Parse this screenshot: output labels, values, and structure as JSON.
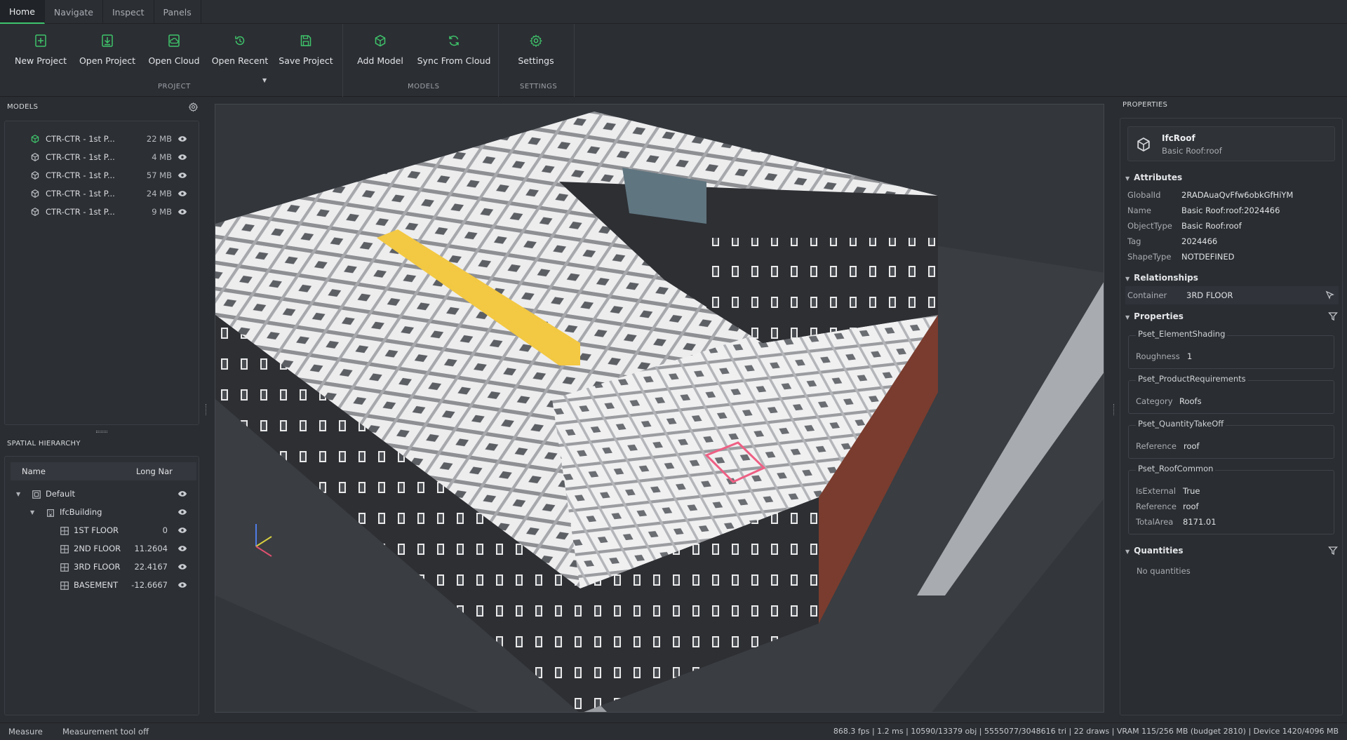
{
  "tabs": [
    {
      "label": "Home",
      "active": true
    },
    {
      "label": "Navigate",
      "active": false
    },
    {
      "label": "Inspect",
      "active": false
    },
    {
      "label": "Panels",
      "active": false
    }
  ],
  "ribbon": {
    "buttons": {
      "new_project": "New Project",
      "open_project": "Open Project",
      "open_cloud": "Open Cloud",
      "open_recent": "Open Recent",
      "save_project": "Save Project",
      "add_model": "Add Model",
      "sync_from_cloud": "Sync From Cloud",
      "settings": "Settings"
    },
    "groups": {
      "project": "PROJECT",
      "models": "MODELS",
      "settings": "SETTINGS"
    },
    "accent": "#3fc46b"
  },
  "models_panel": {
    "title": "MODELS",
    "items": [
      {
        "name": "CTR-CTR - 1st P...",
        "size": "22 MB",
        "active": true
      },
      {
        "name": "CTR-CTR - 1st P...",
        "size": "4 MB",
        "active": false
      },
      {
        "name": "CTR-CTR - 1st P...",
        "size": "57 MB",
        "active": false
      },
      {
        "name": "CTR-CTR - 1st P...",
        "size": "24 MB",
        "active": false
      },
      {
        "name": "CTR-CTR - 1st P...",
        "size": "9 MB",
        "active": false
      }
    ]
  },
  "spatial_hierarchy": {
    "title": "SPATIAL HIERARCHY",
    "col_name": "Name",
    "col_long_name": "Long Nar",
    "nodes": {
      "default": "Default",
      "building": "IfcBuilding",
      "floors": [
        {
          "name": "1ST FLOOR",
          "value": "0"
        },
        {
          "name": "2ND FLOOR",
          "value": "11.2604"
        },
        {
          "name": "3RD FLOOR",
          "value": "22.4167"
        },
        {
          "name": "BASEMENT",
          "value": "-12.6667"
        }
      ]
    }
  },
  "properties": {
    "title": "PROPERTIES",
    "entity_type": "IfcRoof",
    "entity_name": "Basic Roof:roof",
    "attributes_title": "Attributes",
    "attributes": [
      {
        "key": "GlobalId",
        "value": "2RADAuaQvFfw6obkGfHiYM"
      },
      {
        "key": "Name",
        "value": "Basic Roof:roof:2024466"
      },
      {
        "key": "ObjectType",
        "value": "Basic Roof:roof"
      },
      {
        "key": "Tag",
        "value": "2024466"
      },
      {
        "key": "ShapeType",
        "value": "NOTDEFINED"
      }
    ],
    "relationships_title": "Relationships",
    "container_key": "Container",
    "container_value": "3RD FLOOR",
    "properties_title": "Properties",
    "psets": {
      "shading_title": "Pset_ElementShading",
      "shading_key": "Roughness",
      "shading_value": "1",
      "product_title": "Pset_ProductRequirements",
      "product_key": "Category",
      "product_value": "Roofs",
      "qto_title": "Pset_QuantityTakeOff",
      "qto_key": "Reference",
      "qto_value": "roof",
      "roof_title": "Pset_RoofCommon",
      "roof_rows": [
        {
          "key": "IsExternal",
          "value": "True"
        },
        {
          "key": "Reference",
          "value": "roof"
        },
        {
          "key": "TotalArea",
          "value": "8171.01"
        }
      ]
    },
    "quantities_title": "Quantities",
    "no_quantities": "No quantities"
  },
  "status": {
    "tool": "Measure",
    "tool_state": "Measurement tool off",
    "perf": "868.3 fps | 1.2 ms | 10590/13379 obj | 5555077/3048616 tri | 22 draws | VRAM 115/256 MB (budget 2810) | Device 1420/4096 MB"
  }
}
